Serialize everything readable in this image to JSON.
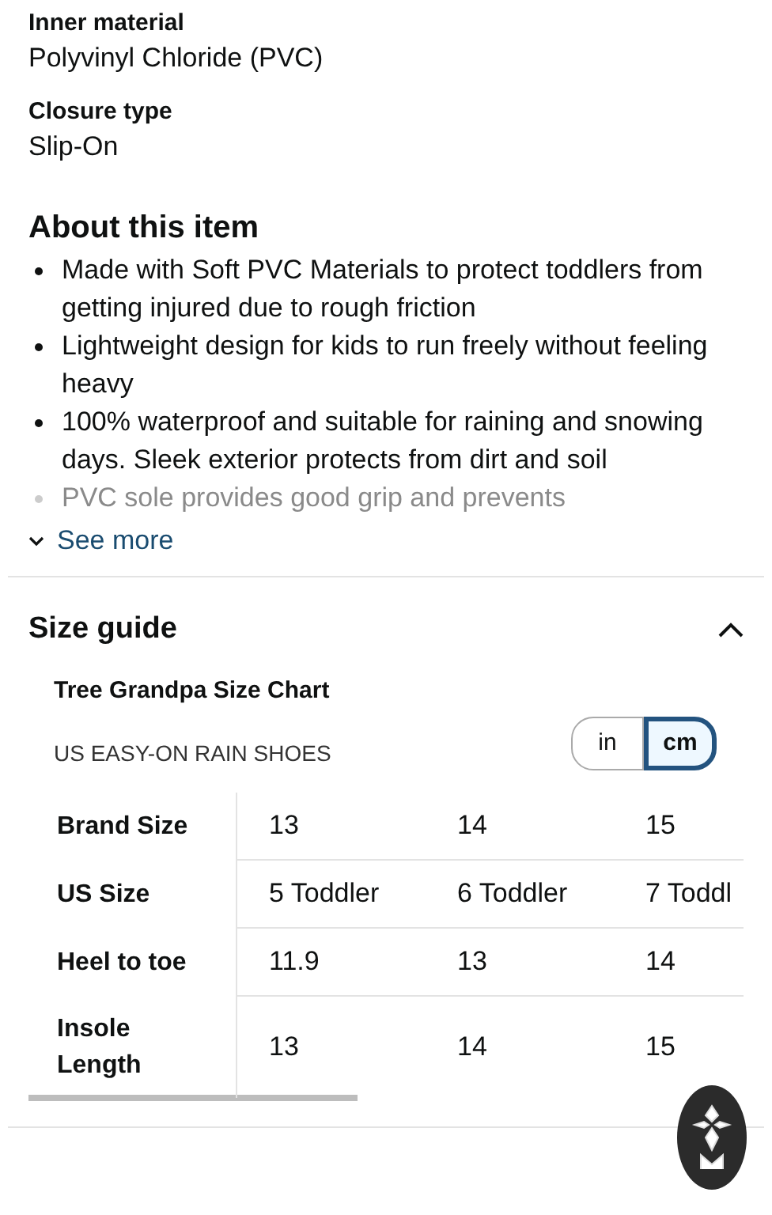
{
  "specs": [
    {
      "label": "Inner material",
      "value": "Polyvinyl Chloride (PVC)"
    },
    {
      "label": "Closure type",
      "value": "Slip-On"
    }
  ],
  "about": {
    "title": "About this item",
    "bullets": [
      {
        "text": "Made with Soft PVC Materials to protect toddlers from getting injured due to rough friction",
        "faded": false
      },
      {
        "text": "Lightweight design for kids to run freely without feeling heavy",
        "faded": false
      },
      {
        "text": "100% waterproof and suitable for raining and snowing days. Sleek exterior protects from dirt and soil",
        "faded": false
      },
      {
        "text": "PVC sole provides good grip and prevents",
        "faded": true
      }
    ],
    "see_more": "See more"
  },
  "size_guide": {
    "title": "Size guide",
    "expanded": true,
    "chart_title": "Tree Grandpa Size Chart",
    "subtitle": "US EASY-ON RAIN SHOES",
    "units": [
      {
        "label": "in",
        "selected": false
      },
      {
        "label": "cm",
        "selected": true
      }
    ],
    "rows": [
      {
        "header": "Brand Size",
        "cells": [
          "13",
          "14",
          "15"
        ]
      },
      {
        "header": "US Size",
        "cells": [
          "5 Toddler",
          "6 Toddler",
          "7 Toddl"
        ]
      },
      {
        "header": "Heel to toe",
        "cells": [
          "11.9",
          "13",
          "14"
        ]
      },
      {
        "header": "Insole Length",
        "cells": [
          "13",
          "14",
          "15"
        ]
      }
    ]
  }
}
